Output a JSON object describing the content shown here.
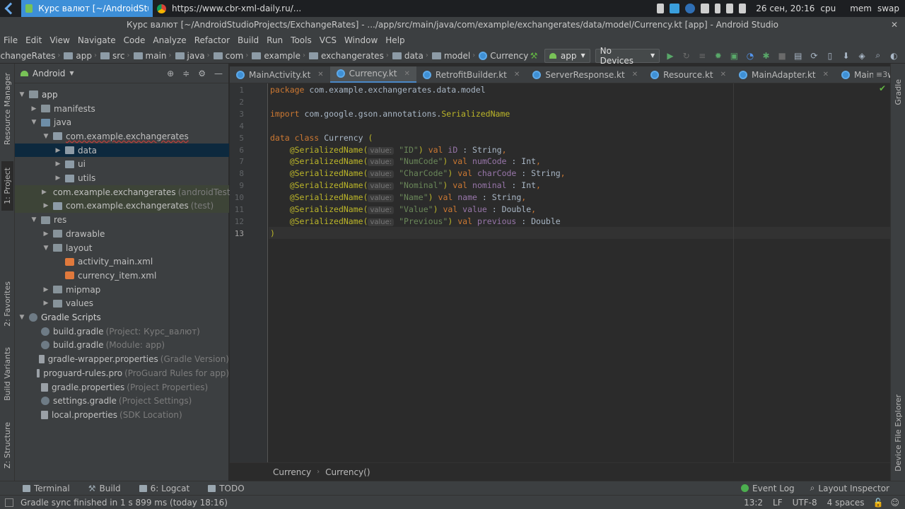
{
  "taskbar": {
    "active_window": "Курс валют [~/AndroidStudi...",
    "browser_window": "https://www.cbr-xml-daily.ru/...",
    "datetime": "26 сен, 20:16",
    "cpu_label": "cpu",
    "mem_label": "mem",
    "swap_label": "swap"
  },
  "window_title": "Курс валют [~/AndroidStudioProjects/ExchangeRates] - .../app/src/main/java/com/example/exchangerates/data/model/Currency.kt [app] - Android Studio",
  "menu": [
    "File",
    "Edit",
    "View",
    "Navigate",
    "Code",
    "Analyze",
    "Refactor",
    "Build",
    "Run",
    "Tools",
    "VCS",
    "Window",
    "Help"
  ],
  "breadcrumb": [
    "ExchangeRates",
    "app",
    "src",
    "main",
    "java",
    "com",
    "example",
    "exchangerates",
    "data",
    "model",
    "Currency"
  ],
  "toolbar": {
    "run_config": "app",
    "device": "No Devices"
  },
  "left_tabs": {
    "resource_manager": "Resource Manager",
    "project": "1: Project",
    "favorites": "2: Favorites",
    "build_variants": "Build Variants",
    "structure": "Z: Structure"
  },
  "right_tabs": {
    "gradle": "Gradle",
    "device_explorer": "Device File Explorer"
  },
  "project_panel": {
    "view": "Android",
    "tree": [
      {
        "label": "app",
        "hint": "",
        "depth": 0,
        "arrow": "down",
        "icon": "folder-blue",
        "state": ""
      },
      {
        "label": "manifests",
        "hint": "",
        "depth": 1,
        "arrow": "right",
        "icon": "folder-blue",
        "state": ""
      },
      {
        "label": "java",
        "hint": "",
        "depth": 1,
        "arrow": "down",
        "icon": "folder-java",
        "state": ""
      },
      {
        "label": "com.example.exchangerates",
        "hint": "",
        "depth": 2,
        "arrow": "down",
        "icon": "pkg",
        "state": "underline"
      },
      {
        "label": "data",
        "hint": "",
        "depth": 3,
        "arrow": "right",
        "icon": "pkg",
        "state": "selected"
      },
      {
        "label": "ui",
        "hint": "",
        "depth": 3,
        "arrow": "right",
        "icon": "pkg",
        "state": ""
      },
      {
        "label": "utils",
        "hint": "",
        "depth": 3,
        "arrow": "right",
        "icon": "pkg",
        "state": ""
      },
      {
        "label": "com.example.exchangerates",
        "hint": "(androidTest)",
        "depth": 2,
        "arrow": "right",
        "icon": "pkg",
        "state": "test"
      },
      {
        "label": "com.example.exchangerates",
        "hint": "(test)",
        "depth": 2,
        "arrow": "right",
        "icon": "pkg",
        "state": "test"
      },
      {
        "label": "res",
        "hint": "",
        "depth": 1,
        "arrow": "down",
        "icon": "folder-blue",
        "state": ""
      },
      {
        "label": "drawable",
        "hint": "",
        "depth": 2,
        "arrow": "right",
        "icon": "folder-blue",
        "state": ""
      },
      {
        "label": "layout",
        "hint": "",
        "depth": 2,
        "arrow": "down",
        "icon": "folder-blue",
        "state": ""
      },
      {
        "label": "activity_main.xml",
        "hint": "",
        "depth": 3,
        "arrow": "",
        "icon": "xml",
        "state": ""
      },
      {
        "label": "currency_item.xml",
        "hint": "",
        "depth": 3,
        "arrow": "",
        "icon": "xml",
        "state": ""
      },
      {
        "label": "mipmap",
        "hint": "",
        "depth": 2,
        "arrow": "right",
        "icon": "folder-blue",
        "state": ""
      },
      {
        "label": "values",
        "hint": "",
        "depth": 2,
        "arrow": "right",
        "icon": "folder-blue",
        "state": ""
      },
      {
        "label": "Gradle Scripts",
        "hint": "",
        "depth": 0,
        "arrow": "down",
        "icon": "gradle",
        "state": ""
      },
      {
        "label": "build.gradle",
        "hint": "(Project: Курс_валют)",
        "depth": 1,
        "arrow": "",
        "icon": "gradle",
        "state": ""
      },
      {
        "label": "build.gradle",
        "hint": "(Module: app)",
        "depth": 1,
        "arrow": "",
        "icon": "gradle",
        "state": ""
      },
      {
        "label": "gradle-wrapper.properties",
        "hint": "(Gradle Version)",
        "depth": 1,
        "arrow": "",
        "icon": "file",
        "state": ""
      },
      {
        "label": "proguard-rules.pro",
        "hint": "(ProGuard Rules for app)",
        "depth": 1,
        "arrow": "",
        "icon": "file",
        "state": ""
      },
      {
        "label": "gradle.properties",
        "hint": "(Project Properties)",
        "depth": 1,
        "arrow": "",
        "icon": "file",
        "state": ""
      },
      {
        "label": "settings.gradle",
        "hint": "(Project Settings)",
        "depth": 1,
        "arrow": "",
        "icon": "gradle",
        "state": ""
      },
      {
        "label": "local.properties",
        "hint": "(SDK Location)",
        "depth": 1,
        "arrow": "",
        "icon": "file",
        "state": ""
      }
    ]
  },
  "tabs": [
    {
      "label": "MainActivity.kt",
      "active": false,
      "icon": "kt"
    },
    {
      "label": "Currency.kt",
      "active": true,
      "icon": "kt"
    },
    {
      "label": "RetrofitBuilder.kt",
      "active": false,
      "icon": "kt"
    },
    {
      "label": "ServerResponse.kt",
      "active": false,
      "icon": "kt"
    },
    {
      "label": "Resource.kt",
      "active": false,
      "icon": "kt"
    },
    {
      "label": "MainAdapter.kt",
      "active": false,
      "icon": "kt"
    },
    {
      "label": "MainViewModel.kt",
      "active": false,
      "icon": "kt"
    }
  ],
  "tabs_overflow": "≡3",
  "code": {
    "package_kw": "package",
    "package_name": "com.example.exchangerates.data.model",
    "import_kw": "import",
    "import_path": "com.google.gson.annotations.",
    "import_cls": "SerializedName",
    "class_decl_kw": "data class",
    "class_name": "Currency",
    "open_paren": "(",
    "close_paren": ")",
    "param_hint": "value:",
    "annotation": "@SerializedName(",
    "fields": [
      {
        "json": "\"ID\"",
        "name": "iD",
        "type": "String",
        "trail": ","
      },
      {
        "json": "\"NumCode\"",
        "name": "numCode",
        "type": "Int",
        "trail": ","
      },
      {
        "json": "\"CharCode\"",
        "name": "charCode",
        "type": "String",
        "trail": ","
      },
      {
        "json": "\"Nominal\"",
        "name": "nominal",
        "type": "Int",
        "trail": ","
      },
      {
        "json": "\"Name\"",
        "name": "name",
        "type": "String",
        "trail": ","
      },
      {
        "json": "\"Value\"",
        "name": "value",
        "type": "Double",
        "trail": ","
      },
      {
        "json": "\"Previous\"",
        "name": "previous",
        "type": "Double",
        "trail": ""
      }
    ],
    "line_numbers": [
      "1",
      "2",
      "3",
      "4",
      "5",
      "6",
      "7",
      "8",
      "9",
      "10",
      "11",
      "12",
      "13"
    ],
    "current_line": "13"
  },
  "editor_breadcrumb": [
    "Currency",
    "Currency()"
  ],
  "bottom_tools": {
    "terminal": "Terminal",
    "build": "Build",
    "logcat": "6: Logcat",
    "todo": "TODO",
    "event_log": "Event Log",
    "layout_inspector": "Layout Inspector"
  },
  "status": {
    "message": "Gradle sync finished in 1 s 899 ms (today 18:16)",
    "position": "13:2",
    "line_sep": "LF",
    "encoding": "UTF-8",
    "indent": "4 spaces"
  },
  "colors": {
    "accent": "#4a88c7",
    "selected_row": "#0d293e",
    "keyword": "#cc7832",
    "string": "#6a8759",
    "annotation": "#bbb529",
    "property": "#9876aa"
  }
}
